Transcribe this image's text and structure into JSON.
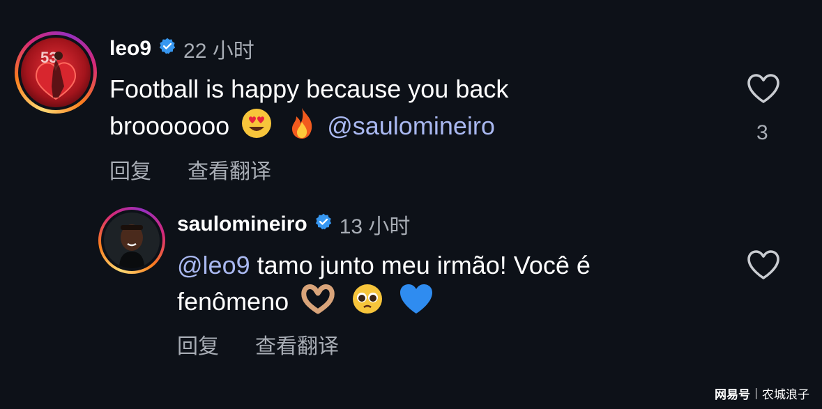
{
  "comments": [
    {
      "username": "leo9",
      "time": "22 小时",
      "text_line1": "Football is happy because you back",
      "text_line2": "brooooooo",
      "mention": "@saulomineiro",
      "reply_label": "回复",
      "translate_label": "查看翻译",
      "likes": "3",
      "emojis": [
        "heart-eyes-emoji",
        "fire-emoji"
      ]
    },
    {
      "username": "saulomineiro",
      "time": "13 小时",
      "mention": "@leo9",
      "text_line1_rest": "tamo junto meu irmão! Você é",
      "text_line2": "fenômeno",
      "reply_label": "回复",
      "translate_label": "查看翻译",
      "emojis": [
        "heart-hands-emoji",
        "pleading-face-emoji",
        "blue-heart-emoji"
      ]
    }
  ],
  "watermark": {
    "brand": "网易号",
    "author": "农城浪子"
  },
  "colors": {
    "background": "#0d1118",
    "mention": "#a9b8f0",
    "secondary_text": "#a8adb5",
    "verified": "#3797f0"
  }
}
